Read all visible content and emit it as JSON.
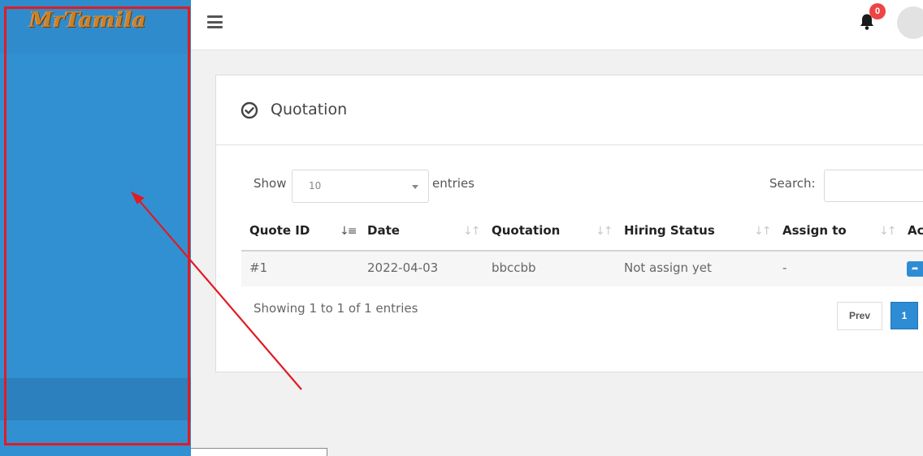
{
  "app": {
    "logo_text": "MrTamila"
  },
  "topbar": {
    "notification_count": "0"
  },
  "card": {
    "title": "Quotation"
  },
  "table_controls": {
    "show_label": "Show",
    "page_length": "10",
    "entries_label": "entries",
    "search_label": "Search:",
    "search_value": ""
  },
  "table": {
    "columns": [
      "Quote ID",
      "Date",
      "Quotation",
      "Hiring Status",
      "Assign to",
      "Ac"
    ],
    "rows": [
      {
        "quote_id": "#1",
        "date": "2022-04-03",
        "quotation": "bbccbb",
        "hiring_status": "Not assign yet",
        "assign_to": "-"
      }
    ]
  },
  "pagination": {
    "info": "Showing 1 to 1 of 1 entries",
    "prev_label": "Prev",
    "current_page": "1"
  },
  "colors": {
    "sidebar": "#3190d1",
    "accent": "#2e8cd4",
    "badge": "#ef4444",
    "annotation": "#e01b24"
  },
  "icons": [
    "hamburger-icon",
    "bell-icon",
    "check-circle-icon",
    "sort-icon",
    "reply-icon"
  ]
}
